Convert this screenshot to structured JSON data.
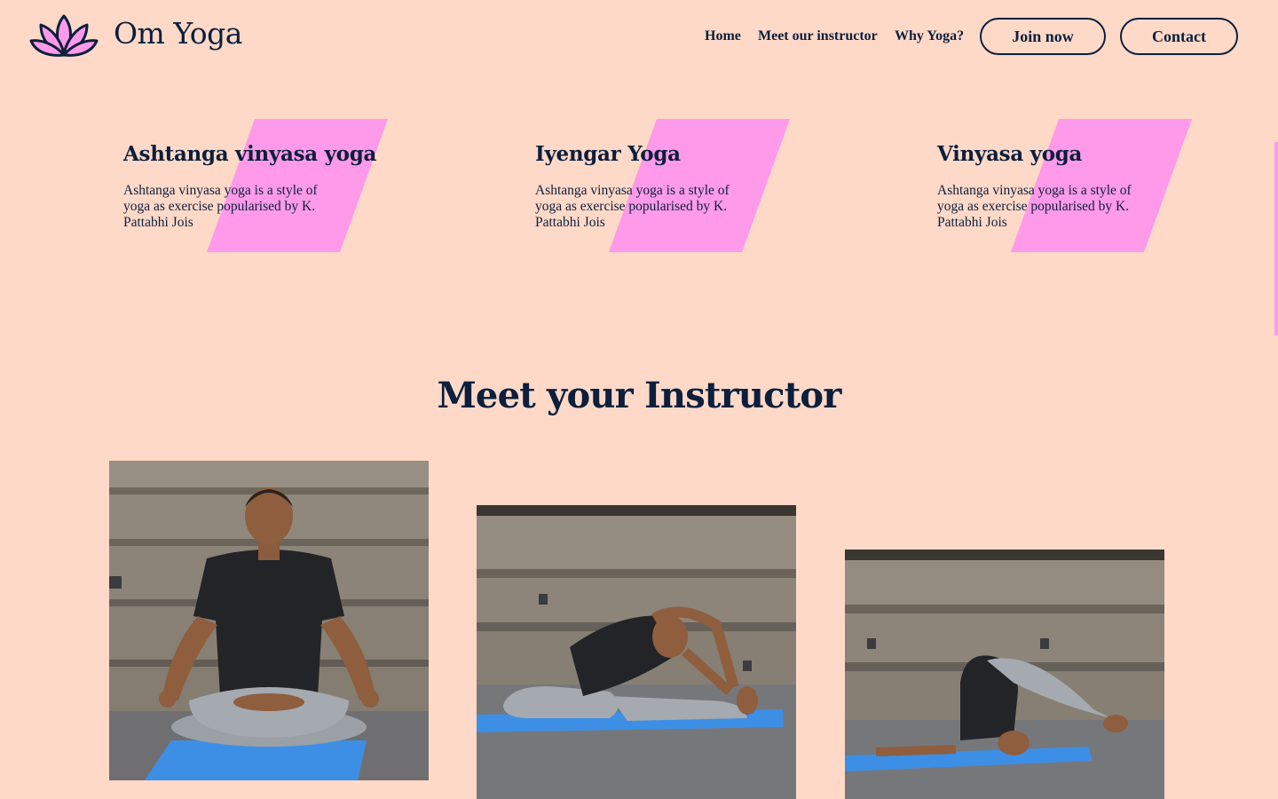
{
  "brand": {
    "name": "Om Yoga",
    "icon": "lotus-icon"
  },
  "nav": {
    "home": "Home",
    "instructor": "Meet our instructor",
    "why": "Why Yoga?",
    "join": "Join now",
    "contact": "Contact"
  },
  "styles": [
    {
      "title": "Ashtanga vinyasa yoga",
      "text": "Ashtanga vinyasa yoga is a style of yoga as exercise popularised by K. Pattabhi Jois"
    },
    {
      "title": "Iyengar Yoga",
      "text": "Ashtanga vinyasa yoga is a style of yoga as exercise popularised by K. Pattabhi Jois"
    },
    {
      "title": "Vinyasa yoga",
      "text": "Ashtanga vinyasa yoga is a style of yoga as exercise popularised by K. Pattabhi Jois"
    }
  ],
  "instructor": {
    "heading": "Meet your Instructor"
  },
  "colors": {
    "background": "#fed9c8",
    "accent": "#fe9ae9",
    "text": "#0c1f3c"
  }
}
